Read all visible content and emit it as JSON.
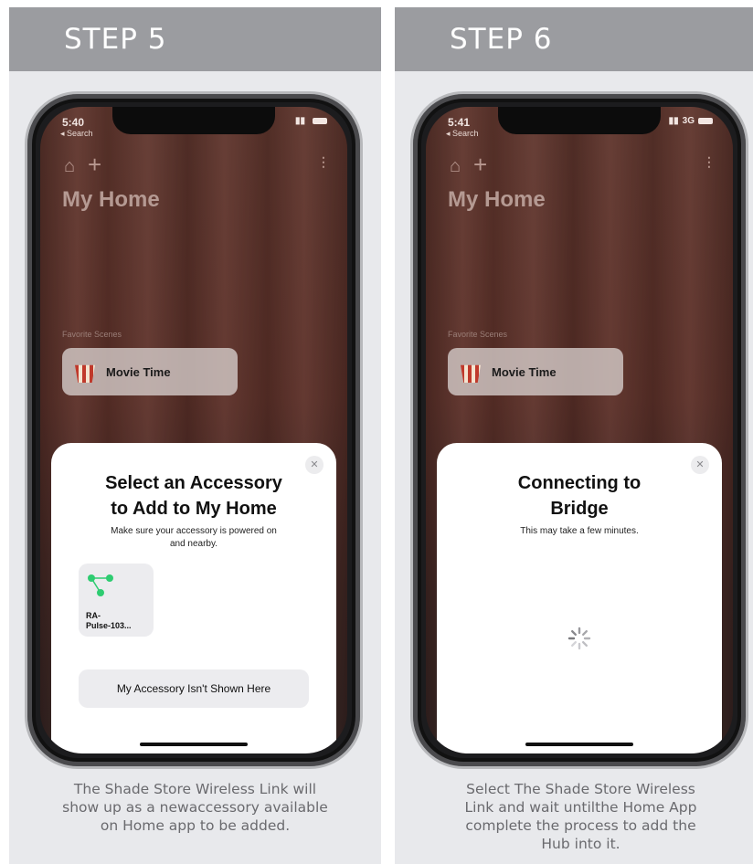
{
  "steps": [
    {
      "header": "STEP 5",
      "status": {
        "time": "5:40",
        "back": "◂ Search",
        "network": ""
      },
      "home_title": "My Home",
      "favorite_scenes_label": "Favorite Scenes",
      "scene_name": "Movie Time",
      "sheet": {
        "title_line1": "Select an Accessory",
        "title_line2": "to Add to My Home",
        "subtitle_line1": "Make sure your accessory is powered on",
        "subtitle_line2": "and nearby.",
        "accessory_label_line1": "RA-",
        "accessory_label_line2": "Pulse-103...",
        "button_label": "My Accessory Isn't Shown Here"
      },
      "caption_lines": [
        "The Shade Store Wireless Link will",
        "show up as a newaccessory available",
        "on Home app to be added."
      ]
    },
    {
      "header": "STEP 6",
      "status": {
        "time": "5:41",
        "back": "◂ Search",
        "network": "3G"
      },
      "home_title": "My Home",
      "favorite_scenes_label": "Favorite Scenes",
      "scene_name": "Movie Time",
      "sheet": {
        "title_line1": "Connecting to",
        "title_line2": "Bridge",
        "subtitle_line1": "This may take a few minutes."
      },
      "caption_lines": [
        "Select The Shade Store Wireless",
        "Link and wait untilthe Home App",
        "complete the process to add the",
        "Hub into it."
      ]
    }
  ],
  "icons": {
    "close": "close-icon",
    "home": "house-icon",
    "add": "plus-icon",
    "voice": "waveform-icon",
    "scene": "popcorn-icon",
    "accessory": "bridge-icon",
    "progress": "spinner-icon"
  },
  "colors": {
    "header_bg": "#9b9ca0",
    "panel_bg": "#e8e9ec",
    "accessory_dot": "#2ecc71"
  }
}
